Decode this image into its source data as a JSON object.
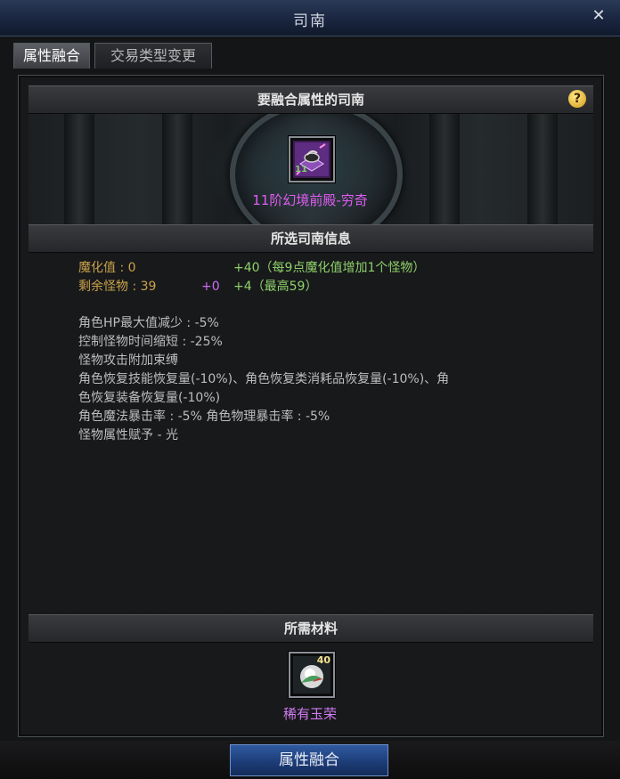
{
  "window": {
    "title": "司南",
    "close_glyph": "✕"
  },
  "tabs": [
    {
      "label": "属性融合",
      "active": true
    },
    {
      "label": "交易类型变更",
      "active": false
    }
  ],
  "sections": {
    "fusion_target": {
      "heading": "要融合属性的司南",
      "help_glyph": "?"
    },
    "selected_info": {
      "heading": "所选司南信息"
    },
    "materials": {
      "heading": "所需材料"
    }
  },
  "target_item": {
    "name": "11阶幻境前殿-穷奇",
    "level_badge": "11",
    "icon": "compass-item-icon"
  },
  "stats": {
    "corruption_label": "魔化值 : 0",
    "corruption_bonus": "+40（每9点魔化值增加1个怪物）",
    "remaining_monsters_label": "剩余怪物 : 39",
    "remaining_monsters_current": "+0",
    "remaining_monsters_bonus": "+4（最高59）"
  },
  "effects": [
    "角色HP最大值减少 : -5%",
    "控制怪物时间缩短 : -25%",
    "怪物攻击附加束缚",
    "角色恢复技能恢复量(-10%)、角色恢复类消耗品恢复量(-10%)、角",
    "色恢复装备恢复量(-10%)",
    "角色魔法暴击率 : -5% 角色物理暴击率 : -5%",
    "怪物属性赋予 - 光"
  ],
  "material_item": {
    "name": "稀有玉荣",
    "quantity": "40",
    "icon": "jade-gem-icon"
  },
  "action_button": {
    "label": "属性融合"
  },
  "colors": {
    "accent_blue": "#1d3d78",
    "item_purple": "#e05cf2",
    "stat_gold": "#c9a24a",
    "bonus_green": "#8ed16a"
  }
}
